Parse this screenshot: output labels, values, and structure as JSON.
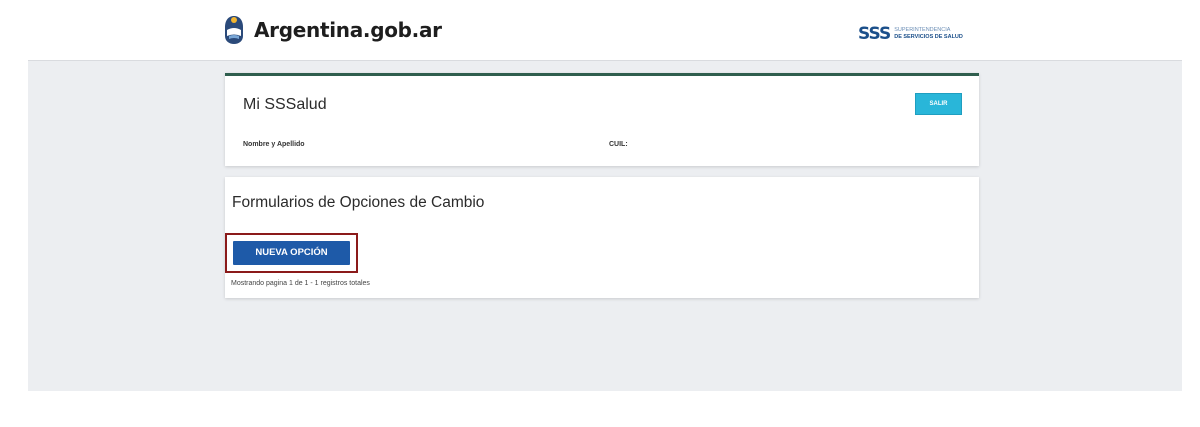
{
  "header": {
    "brand": "Argentina.gob.ar",
    "partner_mark": "SSS",
    "partner_sub_1": "Superintendencia",
    "partner_sub_2": "de Servicios de Salud"
  },
  "profile_card": {
    "title": "Mi SSSalud",
    "logout_label": "Salir",
    "name_label": "Nombre y Apellido",
    "cuil_label": "CUIL:"
  },
  "forms_card": {
    "title": "Formularios de Opciones de Cambio",
    "new_option_label": "NUEVA OPCIÓN",
    "pagination_text": "Mostrando pagina 1 de 1 - 1 registros totales"
  },
  "colors": {
    "header_bar": "#2f5e4e",
    "logout_button": "#29b6d9",
    "primary_button": "#1e5aa8",
    "highlight_frame": "#8b1a1a",
    "page_band": "#eceef1"
  },
  "icons": {
    "brand": "argentina-sun-shield-icon"
  }
}
